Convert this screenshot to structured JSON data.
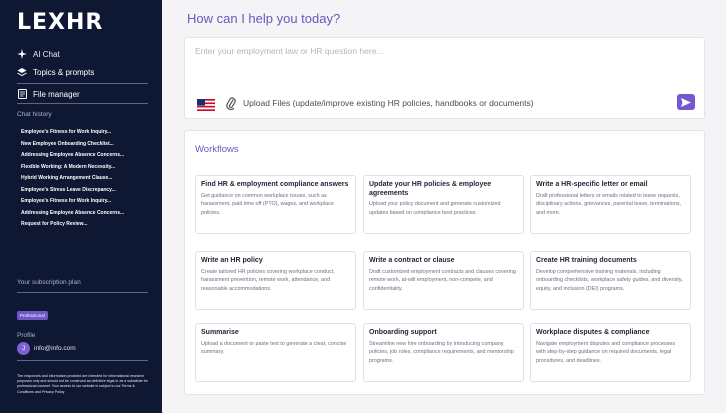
{
  "sidebar": {
    "logo": "LEXHR",
    "nav": {
      "ai_chat": "AI Chat",
      "topics": "Topics & prompts",
      "file_manager": "File manager"
    },
    "history_label": "Chat history",
    "history": [
      "Employee's Fitness for Work Inquiry...",
      "New Employee Onboarding Checklist...",
      "Addressing Employee Absence Concerns...",
      "Flexible Working: A Modern Necessity...",
      "Hybrid Working Arrangement Clause...",
      "Employee's Stress Leave Discrepancy...",
      "Employee's Fitness for Work Inquiry...",
      "Addressing Employee Absence Concerns...",
      "Request for Policy Review..."
    ],
    "subscription_label": "Your subscription plan",
    "plan_badge": "Professional",
    "profile_label": "Profile",
    "avatar_initial": "J",
    "email": "info@info.com",
    "disclaimer": "The responses and information provided are intended for informational research purposes only and should not be construed as definitive legal or as a substitute for professional counsel. Your access to our website is subject to our Terms & Conditions and Privacy Policy"
  },
  "main": {
    "title": "How can I help you today?",
    "input_placeholder": "Enter your employment law or HR question here...",
    "upload_label": "Upload Files (update/improve existing HR policies, handbooks or documents)",
    "workflows_title": "Workflows",
    "workflows": [
      {
        "title": "Find HR & employment compliance answers",
        "desc": "Get guidance on common workplace issues, such as harassment, paid time off (PTO), wages, and workplace policies."
      },
      {
        "title": "Update your HR policies & employee agreements",
        "desc": "Upload your policy document and generate customized updates based on compliance best practices."
      },
      {
        "title": "Write a HR-specific letter or email",
        "desc": "Draft professional letters or emails related to leave requests, disciplinary actions, grievances, parental leave, terminations, and more."
      },
      {
        "title": "Write an HR policy",
        "desc": "Create tailored HR policies covering workplace conduct, harassment prevention, remote work, attendance, and reasonable accommodations."
      },
      {
        "title": "Write a contract or clause",
        "desc": "Draft customized employment contracts and clauses covering remote work, at-will employment, non-compete, and confidentiality."
      },
      {
        "title": "Create HR training documents",
        "desc": "Develop comprehensive training materials, including onboarding checklists, workplace safety guides, and diversity, equity, and inclusion (DEI) programs."
      },
      {
        "title": "Summarise",
        "desc": "Upload a document or paste text to generate a clear, concise summary."
      },
      {
        "title": "Onboarding support",
        "desc": "Streamline new hire onboarding by introducing company policies, job roles, compliance requirements, and mentorship programs."
      },
      {
        "title": "Workplace disputes & compliance",
        "desc": "Navigate employment disputes and compliance processes with step-by-step guidance on required documents, legal procedures, and deadlines."
      }
    ]
  },
  "colors": {
    "sidebar_bg": "#0f1833",
    "accent": "#6b56bf",
    "send_button": "#7558d0"
  },
  "icons": {
    "ai_chat": "sparkle-icon",
    "topics": "layers-icon",
    "file_manager": "document-icon",
    "language": "us-flag-icon",
    "attach": "paperclip-icon",
    "send": "send-icon"
  }
}
